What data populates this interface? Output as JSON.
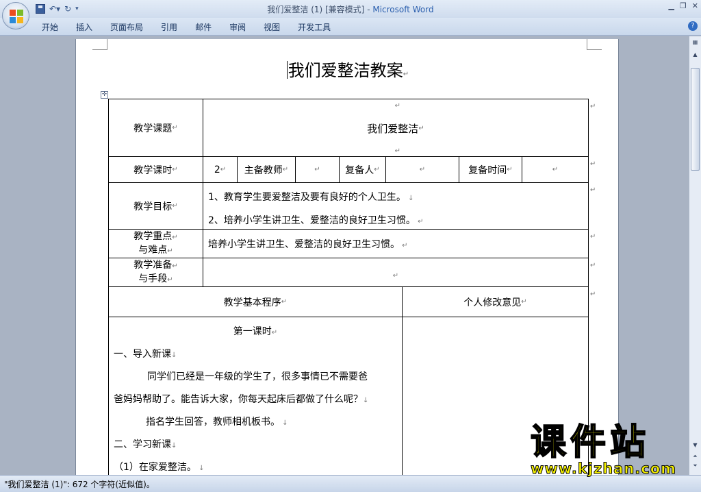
{
  "window": {
    "doc_name": "我们爱整洁 (1) [兼容模式]",
    "separator": " - ",
    "app_name": "Microsoft Word"
  },
  "ribbon_tabs": [
    "开始",
    "插入",
    "页面布局",
    "引用",
    "邮件",
    "审阅",
    "视图",
    "开发工具"
  ],
  "document": {
    "title": "我们爱整洁教案",
    "table": {
      "subject_label": "教学课题",
      "subject_value": "我们爱整洁",
      "hours_label": "教学课时",
      "hours_value": "2",
      "teacher_label": "主备教师",
      "teacher_value": "",
      "backup_label": "复备人",
      "backup_value": "",
      "backup_time_label": "复备时间",
      "backup_time_value": "",
      "goals_label": "教学目标",
      "goals": [
        "1、教育学生要爱整洁及要有良好的个人卫生。",
        "2、培养小学生讲卫生、爱整洁的良好卫生习惯。"
      ],
      "key_label_1": "教学重点",
      "key_label_2": "与难点",
      "key_value": "培养小学生讲卫生、爱整洁的良好卫生习惯。",
      "prep_label_1": "教学准备",
      "prep_label_2": "与手段",
      "prep_value": "",
      "procedure_header": "教学基本程序",
      "revision_header": "个人修改意见",
      "procedure": {
        "lesson": "第一课时",
        "section1": "一、导入新课",
        "para1_line1": "同学们已经是一年级的学生了，很多事情已不需要爸",
        "para1_line2": "爸妈妈帮助了。能告诉大家，你每天起床后都做了什么呢？",
        "para2": "指名学生回答，教师相机板书。",
        "section2": "二、学习新课",
        "item1": "（1）在家爱整洁。"
      }
    }
  },
  "status": {
    "text": "\"我们爱整洁 (1)\": 672 个字符(近似值)。"
  },
  "watermark": {
    "big": "课件站",
    "url": "www.kjzhan.com"
  }
}
